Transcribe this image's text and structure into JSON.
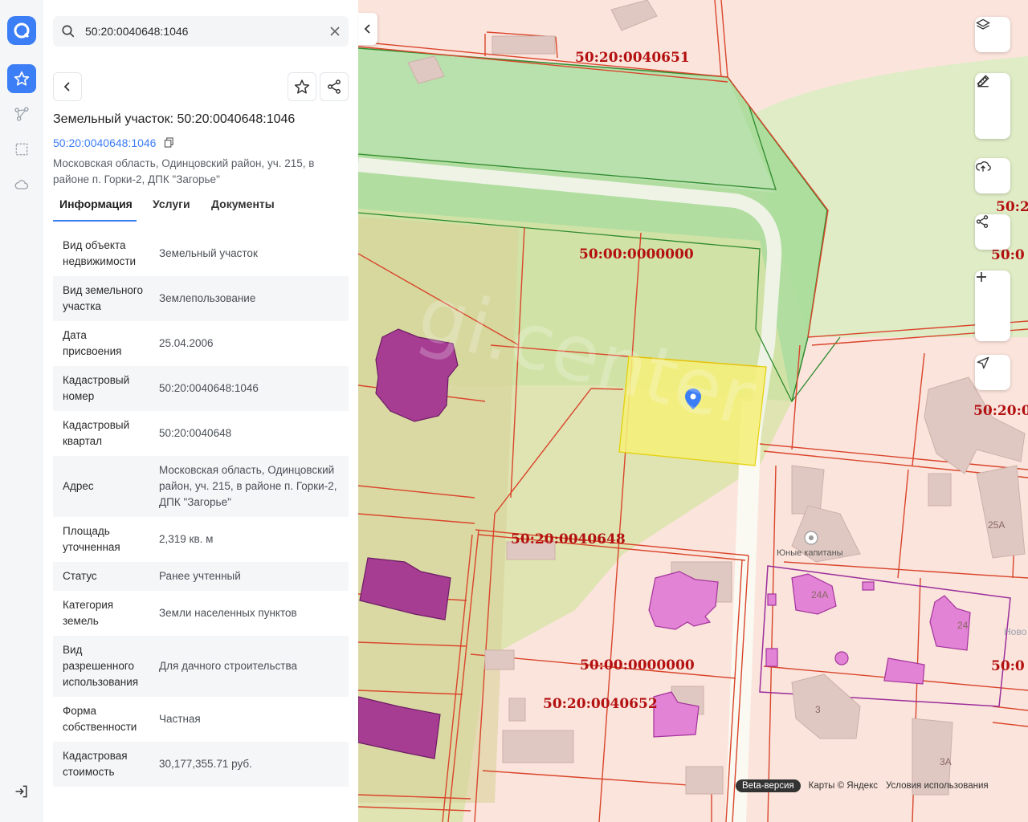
{
  "search": {
    "value": "50:20:0040648:1046"
  },
  "card": {
    "title": "Земельный участок: 50:20:0040648:1046",
    "cad_number": "50:20:0040648:1046",
    "address": "Московская область, Одинцовский район, уч. 215, в районе п. Горки-2, ДПК \"Загорье\""
  },
  "tabs": [
    "Информация",
    "Услуги",
    "Документы"
  ],
  "info": [
    {
      "k": "Вид объекта недвижимости",
      "v": "Земельный участок"
    },
    {
      "k": "Вид земельного участка",
      "v": "Землепользование"
    },
    {
      "k": "Дата присвоения",
      "v": "25.04.2006"
    },
    {
      "k": "Кадастровый номер",
      "v": "50:20:0040648:1046"
    },
    {
      "k": "Кадастровый квартал",
      "v": "50:20:0040648"
    },
    {
      "k": "Адрес",
      "v": "Московская область, Одинцовский район, уч. 215, в районе п. Горки-2, ДПК \"Загорье\""
    },
    {
      "k": "Площадь уточненная",
      "v": "2,319 кв. м"
    },
    {
      "k": "Статус",
      "v": "Ранее учтенный"
    },
    {
      "k": "Категория земель",
      "v": "Земли населенных пунктов"
    },
    {
      "k": "Вид разрешенного использования",
      "v": "Для дачного строительства"
    },
    {
      "k": "Форма собственности",
      "v": "Частная"
    },
    {
      "k": "Кадастровая стоимость",
      "v": "30,177,355.71 руб."
    }
  ],
  "map": {
    "labels": {
      "q0651": "50:20:0040651",
      "z1": "50:00:0000000",
      "q0648": "50:20:0040648",
      "z2": "50:00:0000000",
      "q0652": "50:20:0040652",
      "edge1": "50:2",
      "edge2": "50:0",
      "edge3": "50:20:0",
      "edge4": "50:0",
      "h24a": "24А",
      "h24": "24",
      "h25a": "25А",
      "h3": "3",
      "h3a": "3А",
      "poi": "Юные капитаны",
      "watermark": "gi.center",
      "novo": "Ново"
    }
  },
  "attribution": {
    "beta": "Beta-версия",
    "maps": "Карты © Яндекс",
    "terms": "Условия использования"
  },
  "colors": {
    "accent": "#3c7ef5",
    "parcel_line": "#d9452b",
    "selected": "#f5f07a",
    "forest": "#9ed58f"
  }
}
